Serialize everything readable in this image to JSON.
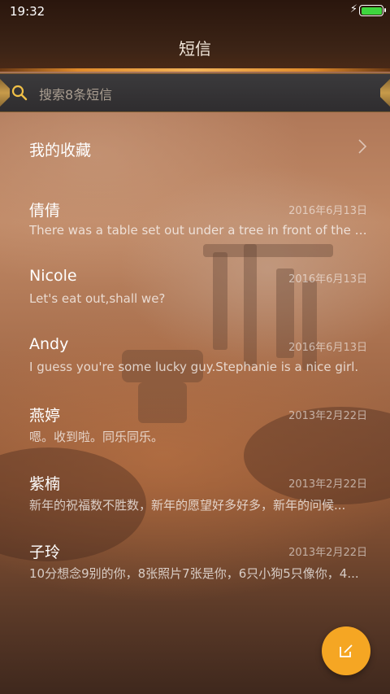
{
  "status_bar": {
    "time": "19:32",
    "battery_level": 1.0,
    "battery_color": "#3ed63e"
  },
  "header": {
    "title": "短信"
  },
  "search": {
    "placeholder": "搜索8条短信",
    "icon": "search-icon"
  },
  "favorites": {
    "label": "我的收藏",
    "icon": "chevron-right-icon"
  },
  "conversations": [
    {
      "name": "倩倩",
      "date": "2016年6月13日",
      "preview": "There was a table set out under a tree in front of the ho..."
    },
    {
      "name": "Nicole",
      "date": "2016年6月13日",
      "preview": "Let's eat out,shall we?"
    },
    {
      "name": "Andy",
      "date": "2016年6月13日",
      "preview": "I guess you're some lucky guy.Stephanie is a nice girl."
    },
    {
      "name": "燕婷",
      "date": "2013年2月22日",
      "preview": "嗯。收到啦。同乐同乐。"
    },
    {
      "name": "紫楠",
      "date": "2013年2月22日",
      "preview": "新年的祝福数不胜数，新年的愿望好多好多，新年的问候..."
    },
    {
      "name": "子玲",
      "date": "2013年2月22日",
      "preview": "10分想念9别的你，8张照片7张是你，6只小狗5只像你，4..."
    }
  ],
  "compose_button": {
    "icon": "compose-icon",
    "color": "#f5a623"
  }
}
